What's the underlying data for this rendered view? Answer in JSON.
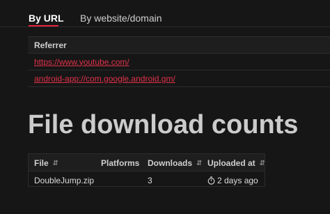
{
  "tabs": {
    "active": "By URL",
    "other": "By website/domain"
  },
  "referrers": {
    "header": "Referrer",
    "rows": [
      "https://www.youtube.com/",
      "android-app://com.google.android.gm/"
    ]
  },
  "heading": "File download counts",
  "downloads_table": {
    "headers": {
      "file": "File",
      "platforms": "Platforms",
      "downloads": "Downloads",
      "uploaded": "Uploaded at"
    },
    "rows": [
      {
        "file": "DoubleJump.zip",
        "platforms": "",
        "downloads": "3",
        "uploaded": "2 days ago"
      }
    ]
  },
  "colors": {
    "accent": "#e0243c",
    "background": "#161616"
  }
}
